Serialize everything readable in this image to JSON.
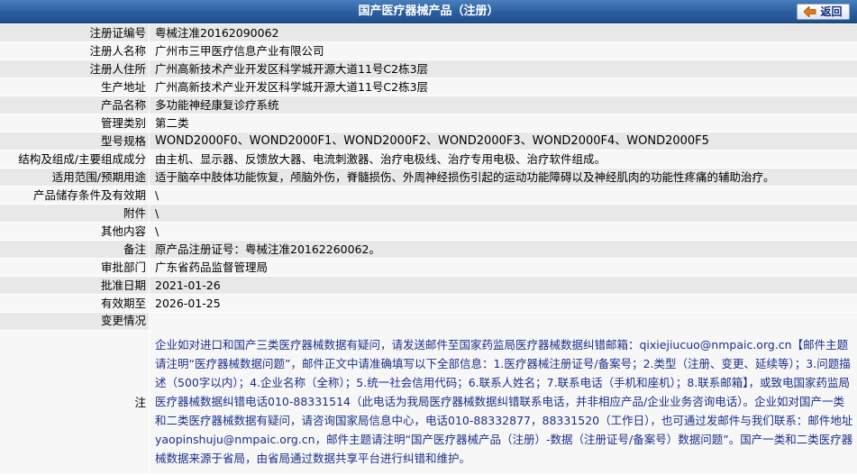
{
  "header": {
    "title": "国产医疗器械产品（注册）",
    "back_label": "返回"
  },
  "rows": [
    {
      "label": "注册证编号",
      "value": "粤械注准20162090062"
    },
    {
      "label": "注册人名称",
      "value": "广州市三甲医疗信息产业有限公司"
    },
    {
      "label": "注册人住所",
      "value": "广州高新技术产业开发区科学城开源大道11号C2栋3层"
    },
    {
      "label": "生产地址",
      "value": "广州高新技术产业开发区科学城开源大道11号C2栋3层"
    },
    {
      "label": "产品名称",
      "value": "多功能神经康复诊疗系统"
    },
    {
      "label": "管理类别",
      "value": "第二类"
    },
    {
      "label": "型号规格",
      "value": "WOND2000F0、WOND2000F1、WOND2000F2、WOND2000F3、WOND2000F4、WOND2000F5"
    },
    {
      "label": "结构及组成/主要组成成分",
      "value": "由主机、显示器、反馈放大器、电流刺激器、治疗电极线、治疗专用电极、治疗软件组成。"
    },
    {
      "label": "适用范围/预期用途",
      "value": "适于脑卒中肢体功能恢复，颅脑外伤，脊髓损伤、外周神经损伤引起的运动功能障碍以及神经肌肉的功能性疼痛的辅助治疗。"
    },
    {
      "label": "产品储存条件及有效期",
      "value": "\\"
    },
    {
      "label": "附件",
      "value": "\\"
    },
    {
      "label": "其他内容",
      "value": "\\"
    },
    {
      "label": "备注",
      "value": "原产品注册证号：粤械注准20162260062。"
    },
    {
      "label": "审批部门",
      "value": "广东省药品监督管理局"
    },
    {
      "label": "批准日期",
      "value": "2021-01-26"
    },
    {
      "label": "有效期至",
      "value": "2026-01-25"
    },
    {
      "label": "变更情况",
      "value": ""
    }
  ],
  "note": {
    "label": "注",
    "text": "企业如对进口和国产三类医疗器械数据有疑问，请发送邮件至国家药监局医疗器械数据纠错邮箱：qixiejiucuo@nmpaic.org.cn【邮件主题请注明“医疗器械数据问题”，邮件正文中请准确填写以下全部信息：1.医疗器械注册证号/备案号；2.类型（注册、变更、延续等）；3.问题描述（500字以内）；4.企业名称（全称）；5.统一社会信用代码；6.联系人姓名；7.联系电话（手机和座机）；8.联系邮箱】，或致电国家药监局医疗器械数据纠错电话010-88331514（此电话为我局医疗器械数据纠错联系电话，并非相应产品/企业业务咨询电话）。企业如对国产一类和二类医疗器械数据有疑问，请咨询国家局信息中心，电话010-88332877，88331520（工作日），也可通过发邮件与我们联系：邮件地址yaopinshuju@nmpaic.org.cn，邮件主题请注明“国产医疗器械产品（注册）-数据（注册证号/备案号）数据问题”。国产一类和二类医疗器械数据来源于省局，由省局通过数据共享平台进行纠错和维护。"
  },
  "colors": {
    "header_bg": "#2a5f9e",
    "row_odd": "#e8e8e8",
    "row_even": "#f7f7f7",
    "note_text": "#1a2f8a"
  }
}
